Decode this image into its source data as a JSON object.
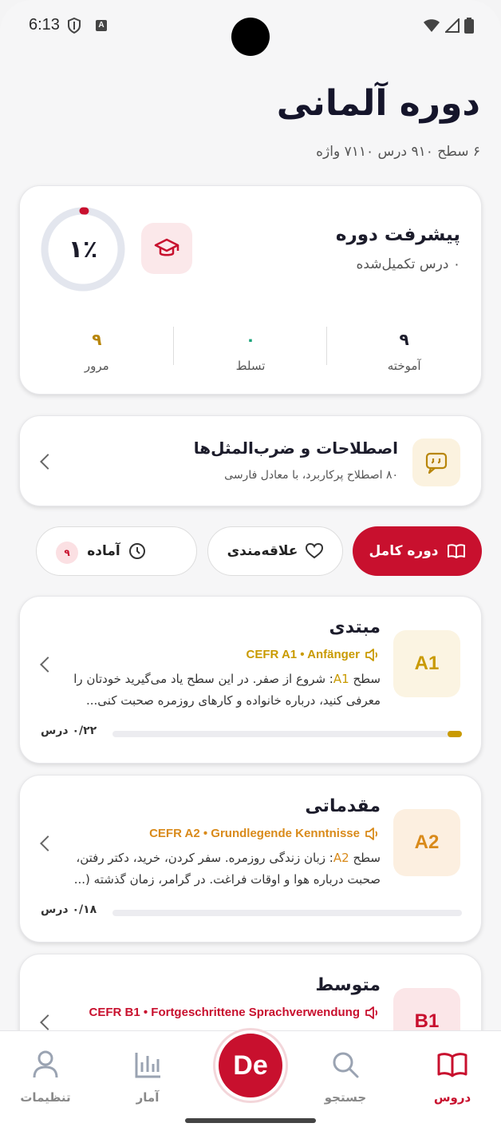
{
  "status_bar": {
    "time": "6:13",
    "a_label": "A"
  },
  "header": {
    "title": "دوره آلمانی",
    "subtitle": "۶ سطح ۹۱۰ درس ۷۱۱۰ واژه"
  },
  "progress": {
    "title": "پیشرفت دوره",
    "subtitle": "۰ درس تکمیل‌شده",
    "percent_label": "۱٪",
    "percent_value": 1,
    "stats": [
      {
        "value": "۹",
        "label": "آموخته",
        "color": "#1c1c2b"
      },
      {
        "value": "۰",
        "label": "تسلط",
        "color": "#1aa37a"
      },
      {
        "value": "۹",
        "label": "مرور",
        "color": "#b8860b"
      }
    ]
  },
  "idioms": {
    "title": "اصطلاحات و ضرب‌المثل‌ها",
    "subtitle": "۸۰ اصطلاح پرکاربرد، با معادل فارسی"
  },
  "filters": {
    "full": "دوره کامل",
    "fav": "علاقه‌مندی",
    "ready": "آماده",
    "ready_badge": "۹"
  },
  "levels": [
    {
      "code": "A1",
      "title": "مبتدی",
      "cefr": "CEFR A1 • Anfänger",
      "desc_prefix": "سطح ",
      "desc_code": "A1",
      "desc_rest": ": شروع از صفر. در این سطح یاد می‌گیرید خودتان را معرفی کنید، درباره خانواده و کارهای روزمره صحبت کنی...",
      "count": "۰/۲۲ درس",
      "progress": 0.04,
      "accent": "#c99a00",
      "box_bg": "#fbf4e2"
    },
    {
      "code": "A2",
      "title": "مقدماتی",
      "cefr": "CEFR A2 • Grundlegende Kenntnisse",
      "desc_prefix": "سطح ",
      "desc_code": "A2",
      "desc_rest": ": زبان زندگی روزمره. سفر کردن، خرید، دکتر رفتن، صحبت درباره هوا و اوقات فراغت. در گرامر، زمان گذشته (...",
      "count": "۰/۱۸ درس",
      "progress": 0,
      "accent": "#d98a1a",
      "box_bg": "#fcefe0"
    },
    {
      "code": "B1",
      "title": "متوسط",
      "cefr": "CEFR B1 • Fortgeschrittene Sprachverwendung",
      "accent": "#c8102e",
      "box_bg": "#fbe6e8"
    }
  ],
  "nav": {
    "lessons": "دروس",
    "search": "جستجو",
    "center": "De",
    "stats": "آمار",
    "settings": "تنظیمات"
  }
}
